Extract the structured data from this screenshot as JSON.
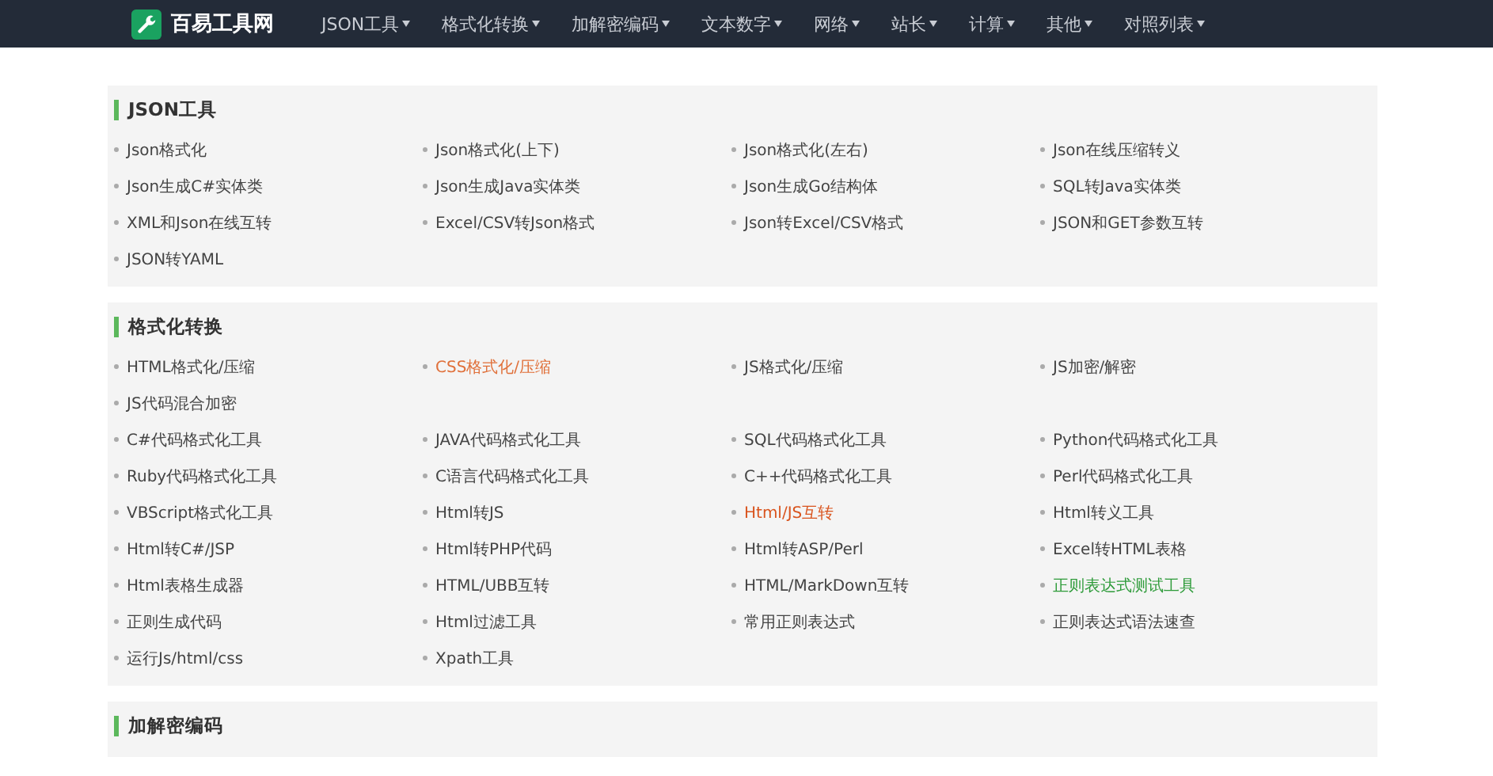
{
  "navbar": {
    "logo": "百易工具网",
    "menu": [
      "JSON工具",
      "格式化转换",
      "加解密编码",
      "文本数字",
      "网络",
      "站长",
      "计算",
      "其他",
      "对照列表"
    ]
  },
  "sections": [
    {
      "title": "JSON工具",
      "rows": [
        [
          {
            "label": "Json格式化"
          },
          {
            "label": "Json格式化(上下)"
          },
          {
            "label": "Json格式化(左右)"
          },
          {
            "label": "Json在线压缩转义"
          }
        ],
        [
          {
            "label": "Json生成C#实体类"
          },
          {
            "label": "Json生成Java实体类"
          },
          {
            "label": "Json生成Go结构体"
          },
          {
            "label": "SQL转Java实体类"
          }
        ],
        [
          {
            "label": "XML和Json在线互转"
          },
          {
            "label": "Excel/CSV转Json格式"
          },
          {
            "label": "Json转Excel/CSV格式"
          },
          {
            "label": "JSON和GET参数互转"
          }
        ],
        [
          {
            "label": "JSON转YAML"
          }
        ]
      ]
    },
    {
      "title": "格式化转换",
      "rows": [
        [
          {
            "label": "HTML格式化/压缩"
          },
          {
            "label": "CSS格式化/压缩",
            "color": "#e0703a"
          },
          {
            "label": "JS格式化/压缩"
          },
          {
            "label": "JS加密/解密"
          }
        ],
        [
          {
            "label": "JS代码混合加密"
          }
        ],
        [
          {
            "label": "C#代码格式化工具"
          },
          {
            "label": "JAVA代码格式化工具"
          },
          {
            "label": "SQL代码格式化工具"
          },
          {
            "label": "Python代码格式化工具"
          }
        ],
        [
          {
            "label": "Ruby代码格式化工具"
          },
          {
            "label": "C语言代码格式化工具"
          },
          {
            "label": "C++代码格式化工具"
          },
          {
            "label": "Perl代码格式化工具"
          }
        ],
        [
          {
            "label": "VBScript格式化工具"
          },
          {
            "label": "Html转JS"
          },
          {
            "label": "Html/JS互转",
            "color": "#d9541e"
          },
          {
            "label": "Html转义工具"
          }
        ],
        [
          {
            "label": "Html转C#/JSP"
          },
          {
            "label": "Html转PHP代码"
          },
          {
            "label": "Html转ASP/Perl"
          },
          {
            "label": "Excel转HTML表格"
          }
        ],
        [
          {
            "label": "Html表格生成器"
          },
          {
            "label": "HTML/UBB互转"
          },
          {
            "label": "HTML/MarkDown互转"
          },
          {
            "label": "正则表达式测试工具",
            "color": "#2e9b3a"
          }
        ],
        [
          {
            "label": "正则生成代码"
          },
          {
            "label": "Html过滤工具"
          },
          {
            "label": "常用正则表达式"
          },
          {
            "label": "正则表达式语法速查"
          }
        ],
        [
          {
            "label": "运行Js/html/css"
          },
          {
            "label": "Xpath工具"
          }
        ]
      ]
    },
    {
      "title": "加解密编码"
    }
  ]
}
